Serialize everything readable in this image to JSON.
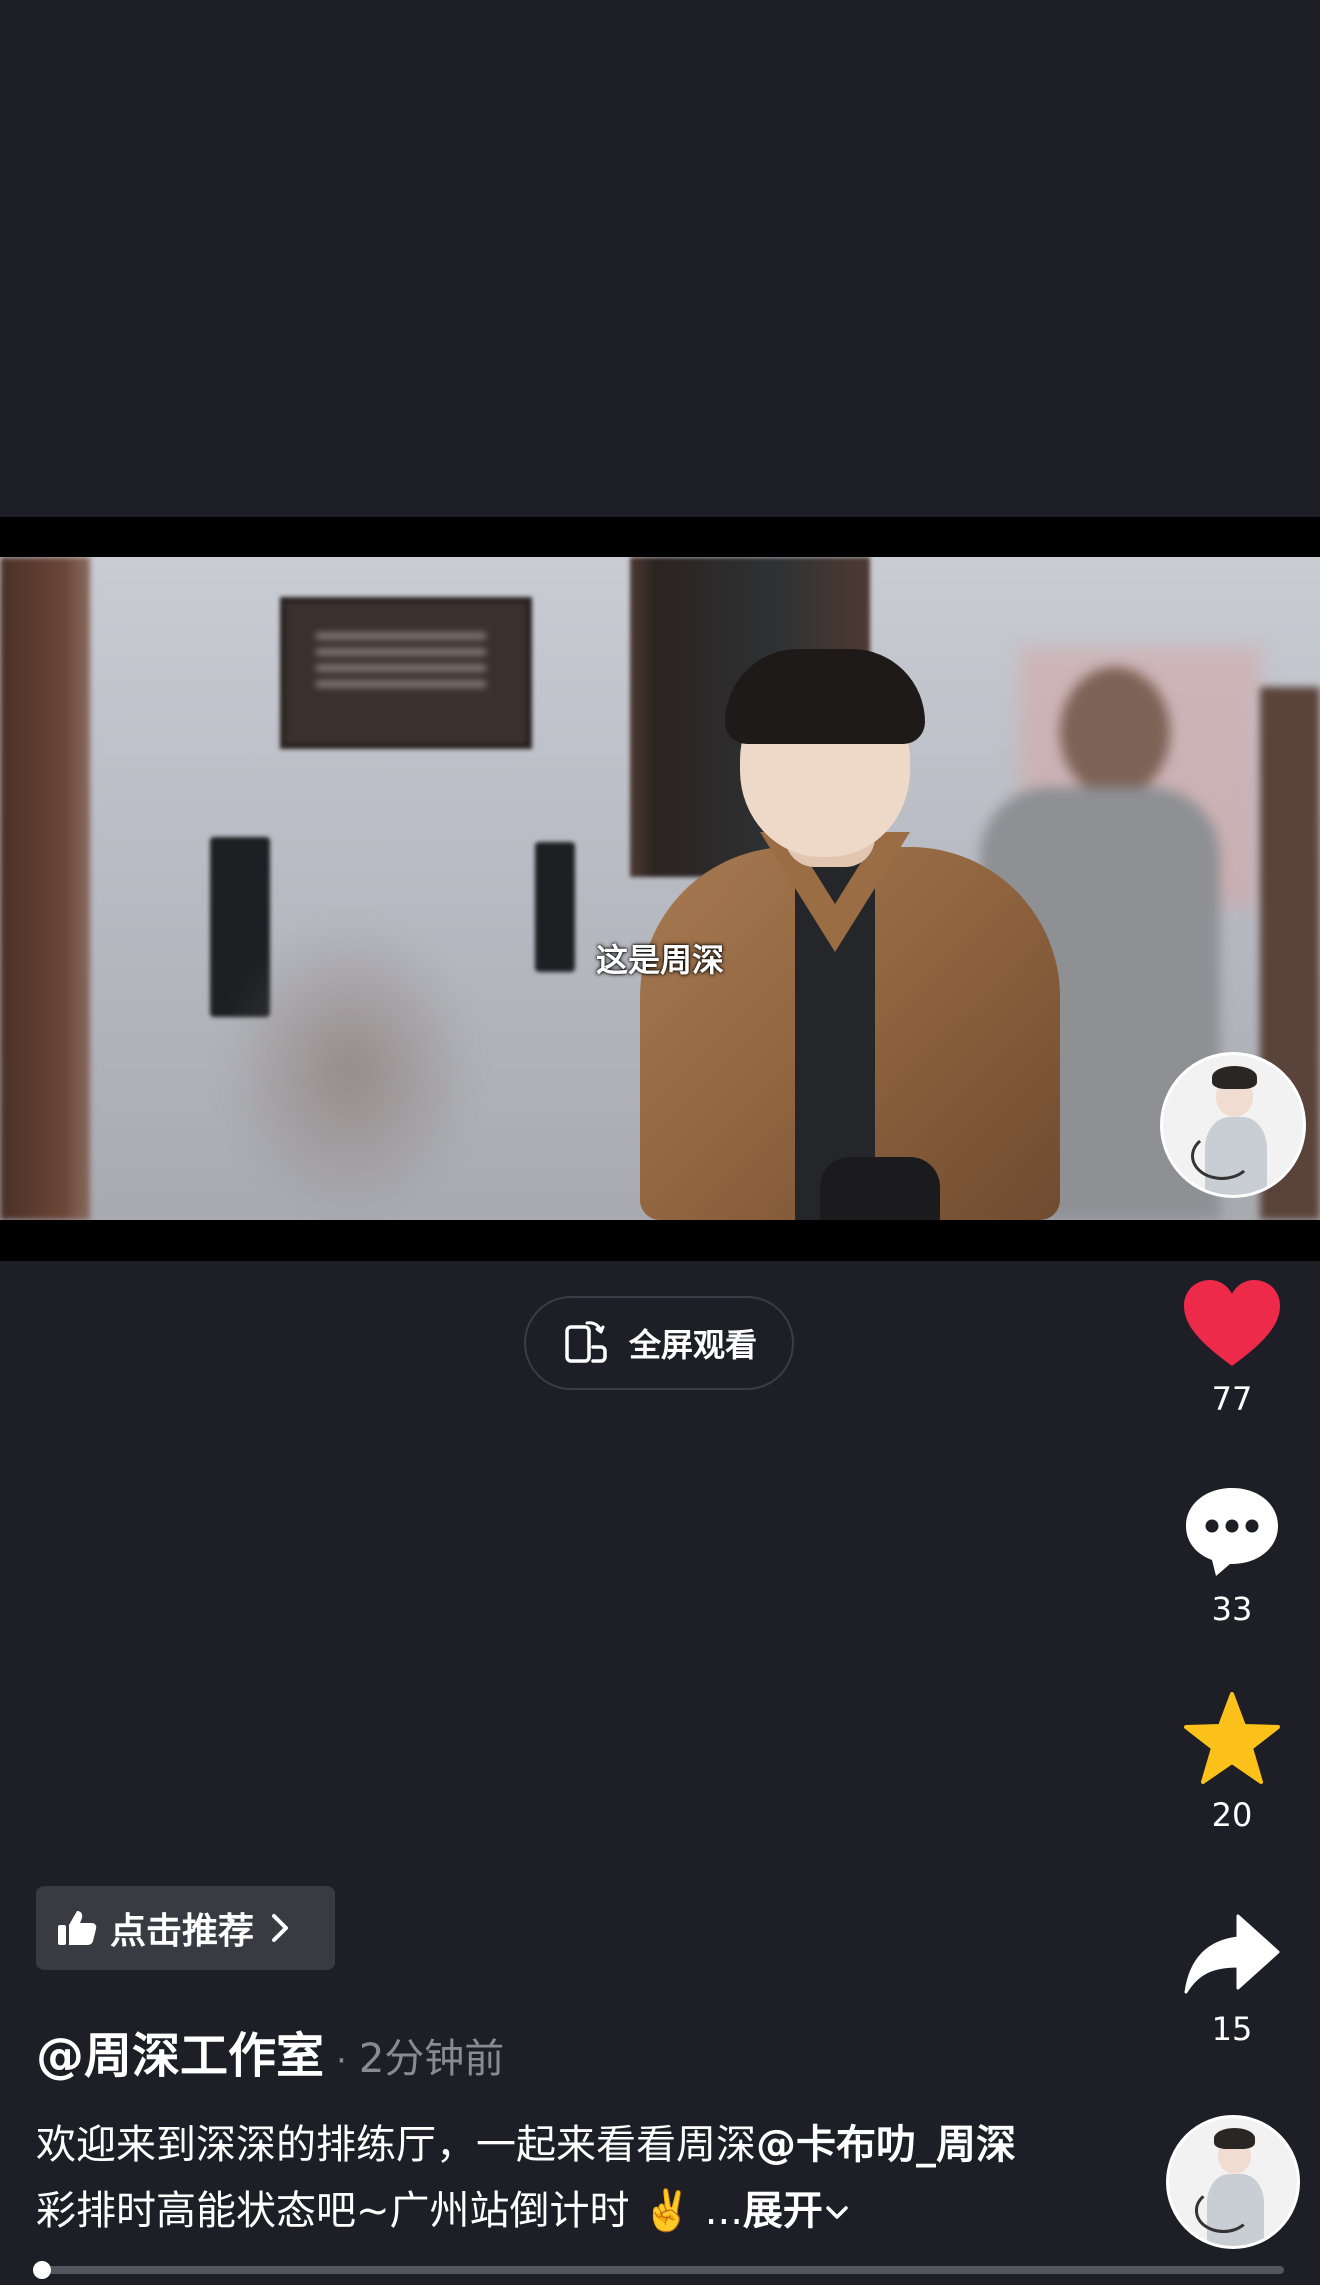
{
  "video": {
    "subtitle": "这是周深"
  },
  "fullscreen": {
    "label": "全屏观看",
    "icon": "rotate-phone-icon"
  },
  "actions": {
    "like": {
      "count": "77",
      "icon": "heart-icon",
      "color": "#ee2a4a"
    },
    "comment": {
      "count": "33",
      "icon": "comment-bubble-icon"
    },
    "favorite": {
      "count": "20",
      "icon": "star-icon",
      "color": "#fcc21b"
    },
    "share": {
      "count": "15",
      "icon": "share-arrow-icon"
    }
  },
  "recommend": {
    "label": "点击推荐",
    "icon": "thumbs-up-icon"
  },
  "post": {
    "author": "@周深工作室",
    "separator": "·",
    "time_ago": "2分钟前",
    "caption_part1": "欢迎来到深深的排练厅，一起来看看周深",
    "mention": "@卡布叻_周深",
    "caption_part2": " 彩排时高能状态吧~广州站倒计时",
    "emoji": "✌️",
    "ellipsis": "...",
    "expand_label": "展开"
  },
  "playback": {
    "progress": 0.005
  }
}
